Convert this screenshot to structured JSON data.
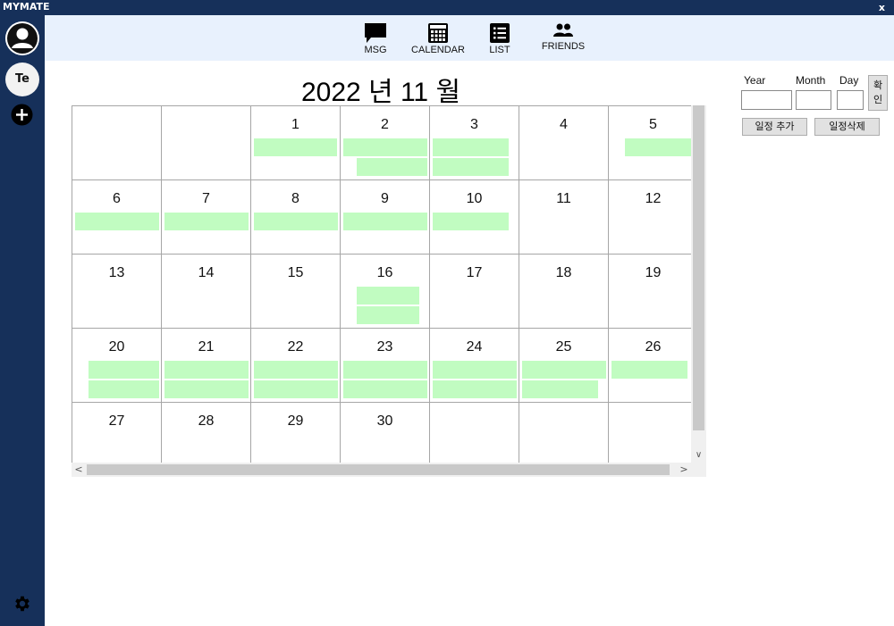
{
  "window": {
    "title": "MYMATE",
    "close_label": "x"
  },
  "sidebar": {
    "profile_icon": "user-avatar-icon",
    "room_label": "Te",
    "add_icon": "plus-circle-icon",
    "settings_icon": "gear-icon"
  },
  "nav": [
    {
      "label": "MSG",
      "icon": "chat-icon"
    },
    {
      "label": "CALENDAR",
      "icon": "calendar-icon"
    },
    {
      "label": "LIST",
      "icon": "list-icon"
    },
    {
      "label": "FRIENDS",
      "icon": "people-icon"
    }
  ],
  "calendar": {
    "title": "2022 년 11 월",
    "year": 2022,
    "month": 11,
    "days": [
      {
        "day": "1",
        "events": 1
      },
      {
        "day": "2",
        "events": 2
      },
      {
        "day": "3",
        "events": 2
      },
      {
        "day": "4",
        "events": 0
      },
      {
        "day": "5",
        "events": 1
      },
      {
        "day": "6",
        "events": 1
      },
      {
        "day": "7",
        "events": 1
      },
      {
        "day": "8",
        "events": 1
      },
      {
        "day": "9",
        "events": 1
      },
      {
        "day": "10",
        "events": 1
      },
      {
        "day": "11",
        "events": 0
      },
      {
        "day": "12",
        "events": 0
      },
      {
        "day": "13",
        "events": 0
      },
      {
        "day": "14",
        "events": 0
      },
      {
        "day": "15",
        "events": 0
      },
      {
        "day": "16",
        "events": 2
      },
      {
        "day": "17",
        "events": 0
      },
      {
        "day": "18",
        "events": 0
      },
      {
        "day": "19",
        "events": 0
      },
      {
        "day": "20",
        "events": 2
      },
      {
        "day": "21",
        "events": 2
      },
      {
        "day": "22",
        "events": 2
      },
      {
        "day": "23",
        "events": 2
      },
      {
        "day": "24",
        "events": 2
      },
      {
        "day": "25",
        "events": 2
      },
      {
        "day": "26",
        "events": 1
      },
      {
        "day": "27",
        "events": 0
      },
      {
        "day": "28",
        "events": 0
      },
      {
        "day": "29",
        "events": 0
      },
      {
        "day": "30",
        "events": 0
      }
    ],
    "event_color": "#c1fcc1"
  },
  "controls": {
    "year_label": "Year",
    "month_label": "Month",
    "day_label": "Day",
    "year_value": "",
    "month_value": "",
    "day_value": "",
    "confirm_label": "확인",
    "add_label": "일정 추가",
    "delete_label": "일정삭제"
  },
  "colors": {
    "sidebar": "#16305a",
    "nav_bg": "#e8f1fd",
    "grid": "#a6a6a6"
  }
}
